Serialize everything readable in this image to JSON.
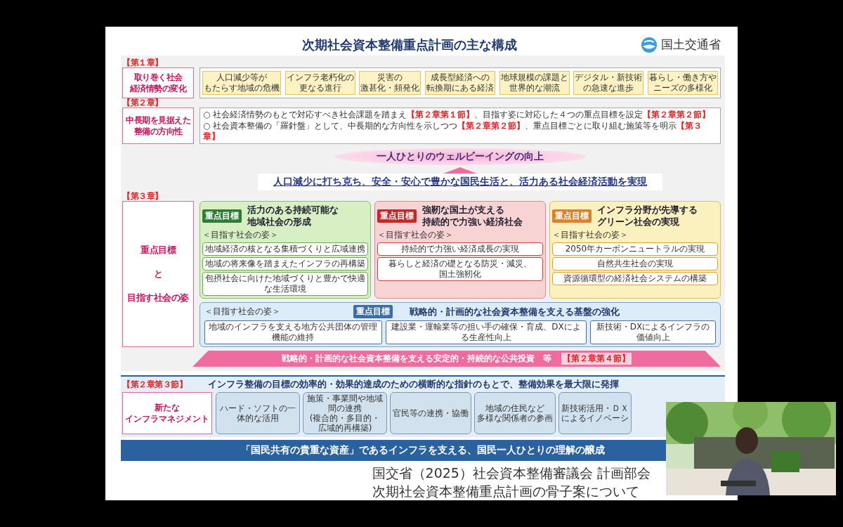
{
  "slide": {
    "title": "次期社会資本整備重点計画の主な構成",
    "logo_text": "国土交通省",
    "chapter1": {
      "tag": "【第１章】",
      "label_lines": [
        "取り巻く社会",
        "経済情勢の変化"
      ],
      "trends": [
        {
          "lines": [
            "人口減少等が",
            "もたらす地域の危機"
          ]
        },
        {
          "lines": [
            "インフラ老朽化の",
            "更なる進行"
          ]
        },
        {
          "lines": [
            "災害の",
            "激甚化・頻発化"
          ]
        },
        {
          "lines": [
            "成長型経済への",
            "転換期にある経済"
          ]
        },
        {
          "lines": [
            "地球規模の課題と",
            "世界的な潮流"
          ]
        },
        {
          "lines": [
            "デジタル・新技術",
            "の急速な進歩"
          ]
        },
        {
          "lines": [
            "暮らし・働き方や",
            "ニーズの多様化"
          ]
        }
      ]
    },
    "chapter2": {
      "tag": "【第２章】",
      "label_lines": [
        "中長期を見据えた",
        "整備の方向性"
      ],
      "bullets": [
        {
          "parts": [
            {
              "kind": "text",
              "text": "○ 社会経済情勢のもとで対応すべき社会課題を踏まえ"
            },
            {
              "kind": "ref",
              "text": "【第２章第１節】"
            },
            {
              "kind": "text",
              "text": "、目指す姿に対応した４つの重点目標を設定"
            },
            {
              "kind": "ref",
              "text": "【第２章第２節】"
            }
          ]
        },
        {
          "parts": [
            {
              "kind": "text",
              "text": "○ 社会資本整備の「羅針盤」として、中長期的な方向性を示しつつ"
            },
            {
              "kind": "ref",
              "text": "【第２章第２節】"
            },
            {
              "kind": "text",
              "text": "、重点目標ごとに取り組む施策等を明示"
            },
            {
              "kind": "ref",
              "text": "【第３章】"
            }
          ]
        }
      ]
    },
    "wellbeing": "一人ひとりのウェルビーイングの向上",
    "vision": "人口減少に打ち克ち、安全・安心で豊かな国民生活と、活力ある社会経済活動を実現",
    "chapter3": {
      "tag": "【第３章】",
      "label_lines": [
        "重点目標",
        "と",
        "目指す社会の姿"
      ],
      "goals": [
        {
          "badge": "重点目標",
          "color": "#2e7d32",
          "title_lines": [
            "活力のある持続可能な",
            "地域社会の形成"
          ],
          "subhead": "＜目指す社会の姿＞",
          "items": [
            [
              "地域経済の核となる集積づくりと広域連携"
            ],
            [
              "地域の将来像を踏まえたインフラの再構築"
            ],
            [
              "包摂社会に向けた地域づくりと豊かで快適な生活環境"
            ]
          ]
        },
        {
          "badge": "重点目標",
          "color": "#c62828",
          "title_lines": [
            "強靭な国土が支える",
            "持続的で力強い経済社会"
          ],
          "subhead": "＜目指す社会の姿＞",
          "items": [
            [
              "持続的で力強い経済成長の実現"
            ],
            [
              "暮らしと経済の礎となる防災・減災、",
              "国土強靭化"
            ]
          ]
        },
        {
          "badge": "重点目標",
          "color": "#d9822b",
          "title_lines": [
            "インフラ分野が先導する",
            "グリーン社会の実現"
          ],
          "subhead": "＜目指す社会の姿＞",
          "items": [
            [
              "2050年カーボンニュートラルの実現"
            ],
            [
              "自然共生社会の実現"
            ],
            [
              "資源循環型の経済社会システムの構築"
            ]
          ]
        }
      ],
      "foundation": {
        "subhead": "＜目指す社会の姿＞",
        "badge": "重点目標",
        "title": "戦略的・計画的な社会資本整備を支える基盤の強化",
        "items": [
          "地域のインフラを支える地方公共団体の管理機能の維持",
          "建設業・運輸業等の担い手の確保・育成、DXによる生産性向上",
          "新技術・DXによるインフラの価値向上"
        ]
      },
      "investment": {
        "text": "戦略的・計画的な社会資本整備を支える安定的・持続的な公共投資　等",
        "ref": "【第２章第４節】"
      }
    },
    "management": {
      "tag": "【第２章第３節】",
      "label_lines": [
        "新たな",
        "インフラマネジメント"
      ],
      "heading": "インフラ整備の目標の効率的・効果的達成のための横断的な指針のもとで、整備効果を最大限に発揮",
      "items": [
        [
          "ハード・ソフトの一体的な活用"
        ],
        [
          "施策・事業間や地域間の連携",
          "(複合的・多目的・広域的再構築)"
        ],
        [
          "官民等の連携・協働"
        ],
        [
          "地域の住民など",
          "多様な関係者の参画"
        ],
        [
          "新技術活用・ＤＸ",
          "によるイノベーシ"
        ]
      ]
    },
    "footer_band": "「国民共有の貴重な資産」であるインフラを支える、国民一人ひとりの理解の醸成",
    "caption": [
      "国交省（2025）社会資本整備審議会 計画部会",
      "次期社会資本整備重点計画の骨子案について"
    ]
  }
}
